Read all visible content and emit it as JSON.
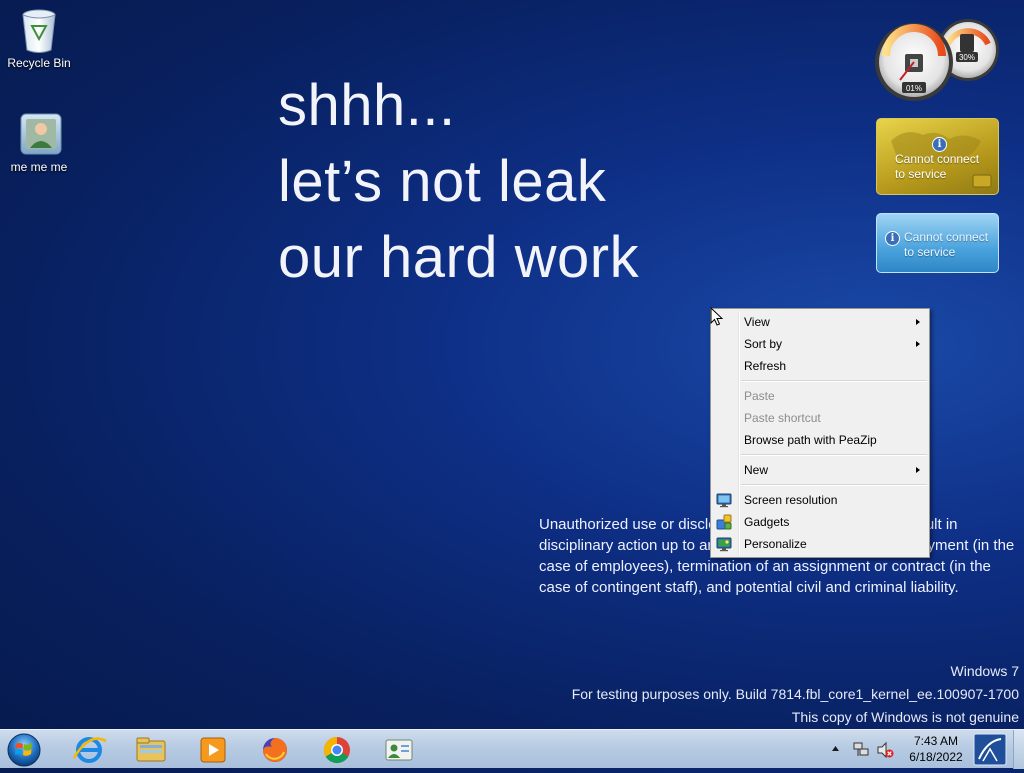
{
  "desktop": {
    "icons": [
      {
        "label": "Recycle Bin",
        "icon": "recycle-bin-icon"
      },
      {
        "label": "me me me",
        "icon": "user-folder-icon"
      }
    ]
  },
  "wallpaper": {
    "headline_lines": [
      "shhh...",
      "let’s not leak",
      "our hard work"
    ],
    "legal_text": "Unauthorized use or disclosure of this information may result in disciplinary action up to and including termination of employment (in the case of employees), termination of an assignment or contract (in the case of contingent staff), and potential civil and criminal liability."
  },
  "gadgets": {
    "cpu_meter": {
      "cpu_percent": "01%",
      "memory_percent": "30%"
    },
    "gold_gadget_text_line1": "Cannot connect",
    "gold_gadget_text_line2": "to service",
    "blue_gadget_text_line1": "Cannot connect",
    "blue_gadget_text_line2": "to service"
  },
  "context_menu": {
    "items": [
      {
        "label": "View",
        "submenu": true,
        "disabled": false
      },
      {
        "label": "Sort by",
        "submenu": true,
        "disabled": false
      },
      {
        "label": "Refresh",
        "submenu": false,
        "disabled": false
      },
      {
        "label": "Paste",
        "submenu": false,
        "disabled": true
      },
      {
        "label": "Paste shortcut",
        "submenu": false,
        "disabled": true
      },
      {
        "label": "Browse path with PeaZip",
        "submenu": false,
        "disabled": false
      },
      {
        "label": "New",
        "submenu": true,
        "disabled": false
      },
      {
        "label": "Screen resolution",
        "submenu": false,
        "disabled": false,
        "icon": "screen-resolution-icon"
      },
      {
        "label": "Gadgets",
        "submenu": false,
        "disabled": false,
        "icon": "gadgets-icon"
      },
      {
        "label": "Personalize",
        "submenu": false,
        "disabled": false,
        "icon": "personalize-icon"
      }
    ]
  },
  "watermark": {
    "line1": "Windows 7",
    "line2": "For testing purposes only. Build 7814.fbl_core1_kernel_ee.100907-1700",
    "line3": "This copy of Windows is not genuine"
  },
  "taskbar": {
    "pinned": [
      {
        "name": "internet-explorer-icon"
      },
      {
        "name": "windows-explorer-icon"
      },
      {
        "name": "media-player-icon"
      },
      {
        "name": "firefox-icon"
      },
      {
        "name": "chrome-icon"
      },
      {
        "name": "contacts-app-icon"
      }
    ],
    "clock": {
      "time": "7:43 AM",
      "date": "6/18/2022"
    }
  },
  "colors": {
    "desktop_bg": "#0e2f86",
    "menu_bg": "#f0f0f0",
    "taskbar_bg": "#b7cbe3"
  }
}
